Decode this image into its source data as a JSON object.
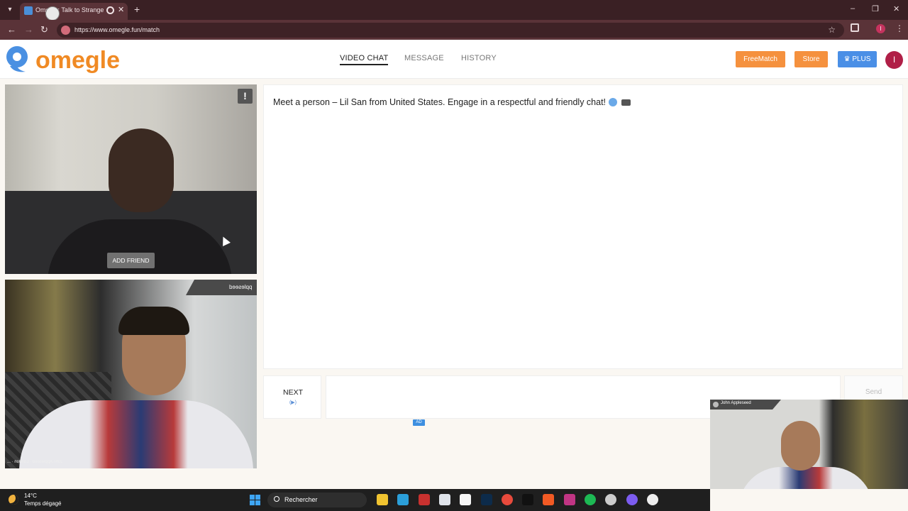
{
  "browser": {
    "tab_title": "Omegle: Talk to Strangers",
    "url": "https://www.omegle.fun/match",
    "new_tab": "+",
    "close_tab": "✕",
    "win_minimize": "–",
    "win_maximize": "❐",
    "win_close": "✕"
  },
  "header": {
    "logo_text": "omegle",
    "nav": {
      "video_chat": "VIDEO CHAT",
      "message": "MESSAGE",
      "history": "HISTORY"
    },
    "buttons": {
      "freematch": "FreeMatch",
      "store": "Store",
      "plus": "PLUS"
    },
    "avatar_initial": "I"
  },
  "stranger": {
    "report": "!",
    "add_friend": "ADD FRIEND"
  },
  "self_view": {
    "tag": "ppleseed",
    "caption": "John Appleseed · London · ..."
  },
  "chat": {
    "intro": "Meet a person – Lil San from United States. Engage in a respectful and friendly chat!",
    "next_label": "NEXT",
    "next_hint": "(▶)",
    "send_label": "Send",
    "ad_badge": "AD"
  },
  "overlay_cam": {
    "tag": "John Appleseed"
  },
  "taskbar": {
    "temperature": "14°C",
    "weather": "Temps dégagé",
    "search_placeholder": "Rechercher"
  },
  "colors": {
    "logo_orange": "#f08a24",
    "logo_blue": "#4a90e2",
    "freematch": "#f5913e",
    "store": "#f5913e",
    "plus": "#4a8fe6",
    "avatar": "#b01f47"
  },
  "taskbar_apps": [
    {
      "icon": "file-explorer-icon",
      "color": "#f0c330"
    },
    {
      "icon": "edge-icon",
      "color": "#2b9fd9"
    },
    {
      "icon": "app-red-icon",
      "color": "#c8312f"
    },
    {
      "icon": "store-icon",
      "color": "#dfe3ea"
    },
    {
      "icon": "search-app-icon",
      "color": "#f5f5f5"
    },
    {
      "icon": "photoshop-icon",
      "color": "#0d2b4a"
    },
    {
      "icon": "chrome-icon",
      "color": "#e84a3c"
    },
    {
      "icon": "tiktok-icon",
      "color": "#111111"
    },
    {
      "icon": "brave-icon",
      "color": "#f25a24"
    },
    {
      "icon": "instagram-icon",
      "color": "#c13584"
    },
    {
      "icon": "spotify-icon",
      "color": "#1db954"
    },
    {
      "icon": "steam-icon",
      "color": "#cccccc"
    },
    {
      "icon": "app-purple-icon",
      "color": "#7c5cf0"
    },
    {
      "icon": "obs-icon",
      "color": "#eeeeee"
    }
  ]
}
